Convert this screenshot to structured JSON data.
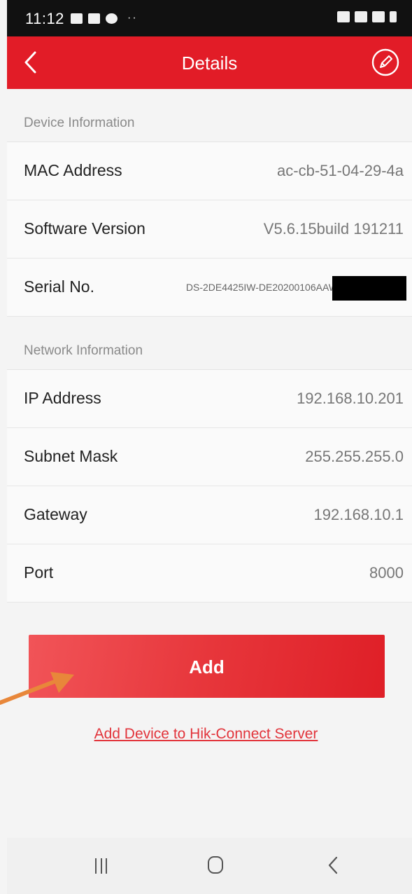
{
  "status_bar": {
    "time": "11:12",
    "left_icons": [
      "gallery-icon",
      "notification-icon",
      "messenger-icon"
    ],
    "overflow": "··",
    "right_icons": [
      "mute-icon",
      "wifi-icon",
      "signal-icon",
      "battery-icon"
    ]
  },
  "header": {
    "title": "Details",
    "back_icon": "chevron-left-icon",
    "edit_icon": "edit-pencil-icon",
    "color": "#e21c27"
  },
  "device_info": {
    "heading": "Device Information",
    "mac_label": "MAC Address",
    "mac_value": "ac-cb-51-04-29-4a",
    "software_label": "Software Version",
    "software_value": "V5.6.15build 191211",
    "serial_label": "Serial No.",
    "serial_value": "DS-2DE4425IW-DE20200106AAW"
  },
  "network_info": {
    "heading": "Network Information",
    "ip_label": "IP Address",
    "ip_value": "192.168.10.201",
    "subnet_label": "Subnet Mask",
    "subnet_value": "255.255.255.0",
    "gateway_label": "Gateway",
    "gateway_value": "192.168.10.1",
    "port_label": "Port",
    "port_value": "8000"
  },
  "actions": {
    "add_label": "Add",
    "server_link": "Add Device to Hik-Connect Server",
    "accent": "#e2343b"
  },
  "annotation": {
    "arrow_color": "#e8873a"
  },
  "nav_bar": {
    "recent_icon": "recent-apps-icon",
    "home_icon": "home-icon",
    "back_icon": "back-icon"
  }
}
